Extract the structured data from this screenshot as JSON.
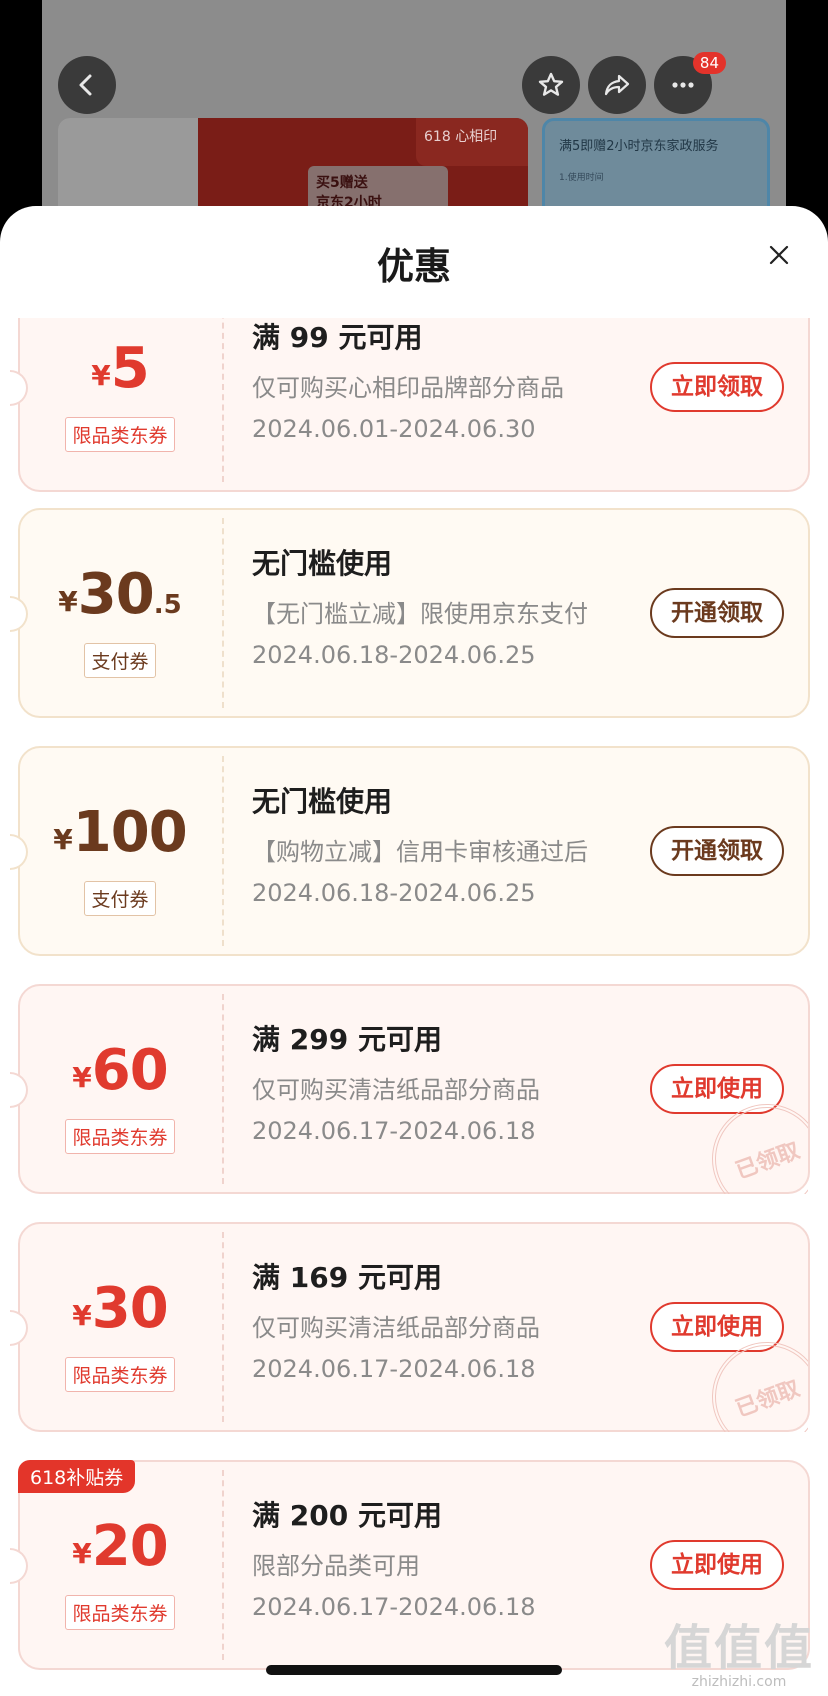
{
  "background": {
    "more_badge": "84",
    "banner_left": {
      "brand": "618",
      "brand_name": "心相印",
      "promo_line1": "买5赠送",
      "promo_line2": "京东2小时"
    },
    "banner_right": {
      "title": "满5即赠2小时京东家政服务",
      "sub": "1.使用时间"
    }
  },
  "sheet": {
    "title": "优惠"
  },
  "coupons": [
    {
      "currency": "¥",
      "amount": "5",
      "decimal": "",
      "type": "限品类东券",
      "title": "满 99 元可用",
      "desc": "仅可购买心相印品牌部分商品",
      "date": "2024.06.01-2024.06.30",
      "action": "立即领取",
      "tag": "",
      "stamp": ""
    },
    {
      "currency": "¥",
      "amount": "30",
      "decimal": ".5",
      "type": "支付券",
      "title": "无门槛使用",
      "desc": "【无门槛立减】限使用京东支付",
      "date": "2024.06.18-2024.06.25",
      "action": "开通领取",
      "tag": "",
      "stamp": ""
    },
    {
      "currency": "¥",
      "amount": "100",
      "decimal": "",
      "type": "支付券",
      "title": "无门槛使用",
      "desc": "【购物立减】信用卡审核通过后",
      "date": "2024.06.18-2024.06.25",
      "action": "开通领取",
      "tag": "",
      "stamp": ""
    },
    {
      "currency": "¥",
      "amount": "60",
      "decimal": "",
      "type": "限品类东券",
      "title": "满 299 元可用",
      "desc": "仅可购买清洁纸品部分商品",
      "date": "2024.06.17-2024.06.18",
      "action": "立即使用",
      "tag": "",
      "stamp": "已领取"
    },
    {
      "currency": "¥",
      "amount": "30",
      "decimal": "",
      "type": "限品类东券",
      "title": "满 169 元可用",
      "desc": "仅可购买清洁纸品部分商品",
      "date": "2024.06.17-2024.06.18",
      "action": "立即使用",
      "tag": "",
      "stamp": "已领取"
    },
    {
      "currency": "¥",
      "amount": "20",
      "decimal": "",
      "type": "限品类东券",
      "title": "满 200 元可用",
      "desc": "限部分品类可用",
      "date": "2024.06.17-2024.06.18",
      "action": "立即使用",
      "tag": "618补贴券",
      "stamp": ""
    }
  ],
  "watermark": {
    "big": "值值值",
    "small": "zhizhizhi.com"
  },
  "colors": {
    "accent_red": "#e03a2e",
    "accent_gold": "#6b3a1e",
    "tag_red": "#e3352a"
  }
}
